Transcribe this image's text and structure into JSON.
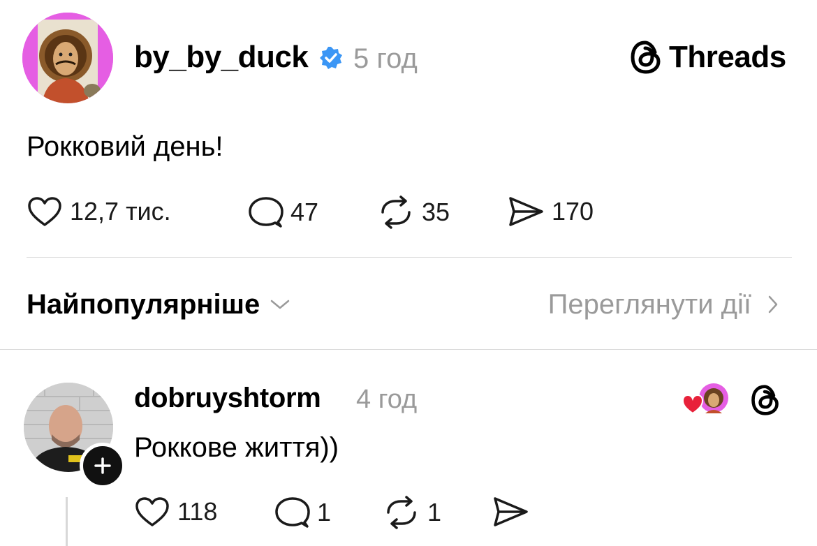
{
  "post": {
    "username": "by_by_duck",
    "time": "5 год",
    "brand": "Threads",
    "text": "Рокковий день!",
    "stats": {
      "likes": "12,7 тис.",
      "comments": "47",
      "reposts": "35",
      "shares": "170"
    }
  },
  "replies_bar": {
    "sort_label": "Найпопулярніше",
    "activity_label": "Переглянути дії"
  },
  "reply": {
    "username": "dobruyshtorm",
    "time": "4 год",
    "text": "Роккове життя))",
    "stats": {
      "likes": "118",
      "comments": "1",
      "reposts": "1"
    }
  },
  "colors": {
    "verified": "#3b96f5",
    "avatar_bg": "#e55ee3",
    "muted": "#9a9a9a",
    "heart": "#e8213a"
  }
}
